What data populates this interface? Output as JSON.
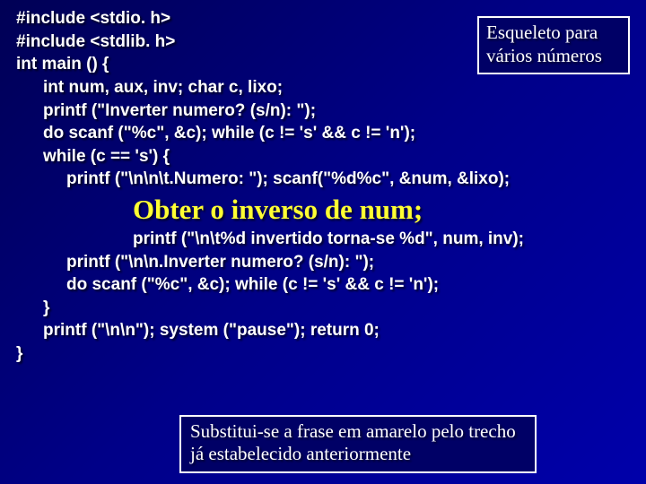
{
  "code": {
    "l1": "#include <stdio. h>",
    "l2": "#include <stdlib. h>",
    "l3": "int main () {",
    "l4": "int num, aux, inv; char c, lixo;",
    "l5": "printf (\"Inverter numero? (s/n): \");",
    "l6": "do scanf (\"%c\", &c); while (c != 's' && c != 'n');",
    "l7": "while (c == 's') {",
    "l8": "printf (\"\\n\\n\\t.Numero: \"); scanf(\"%d%c\", &num, &lixo);",
    "hl": "Obter o inverso de num;",
    "l9": "printf (\"\\n\\t%d invertido torna-se %d\", num, inv);",
    "l10": "printf (\"\\n\\n.Inverter numero? (s/n): \");",
    "l11": "do scanf (\"%c\", &c); while (c != 's' && c != 'n');",
    "l12": "}",
    "l13": "printf (\"\\n\\n\"); system (\"pause\"); return 0;",
    "l14": "}"
  },
  "boxes": {
    "top": "Esqueleto para vários números",
    "bottom": "Substitui-se a frase em amarelo pelo trecho já estabelecido anteriormente"
  }
}
